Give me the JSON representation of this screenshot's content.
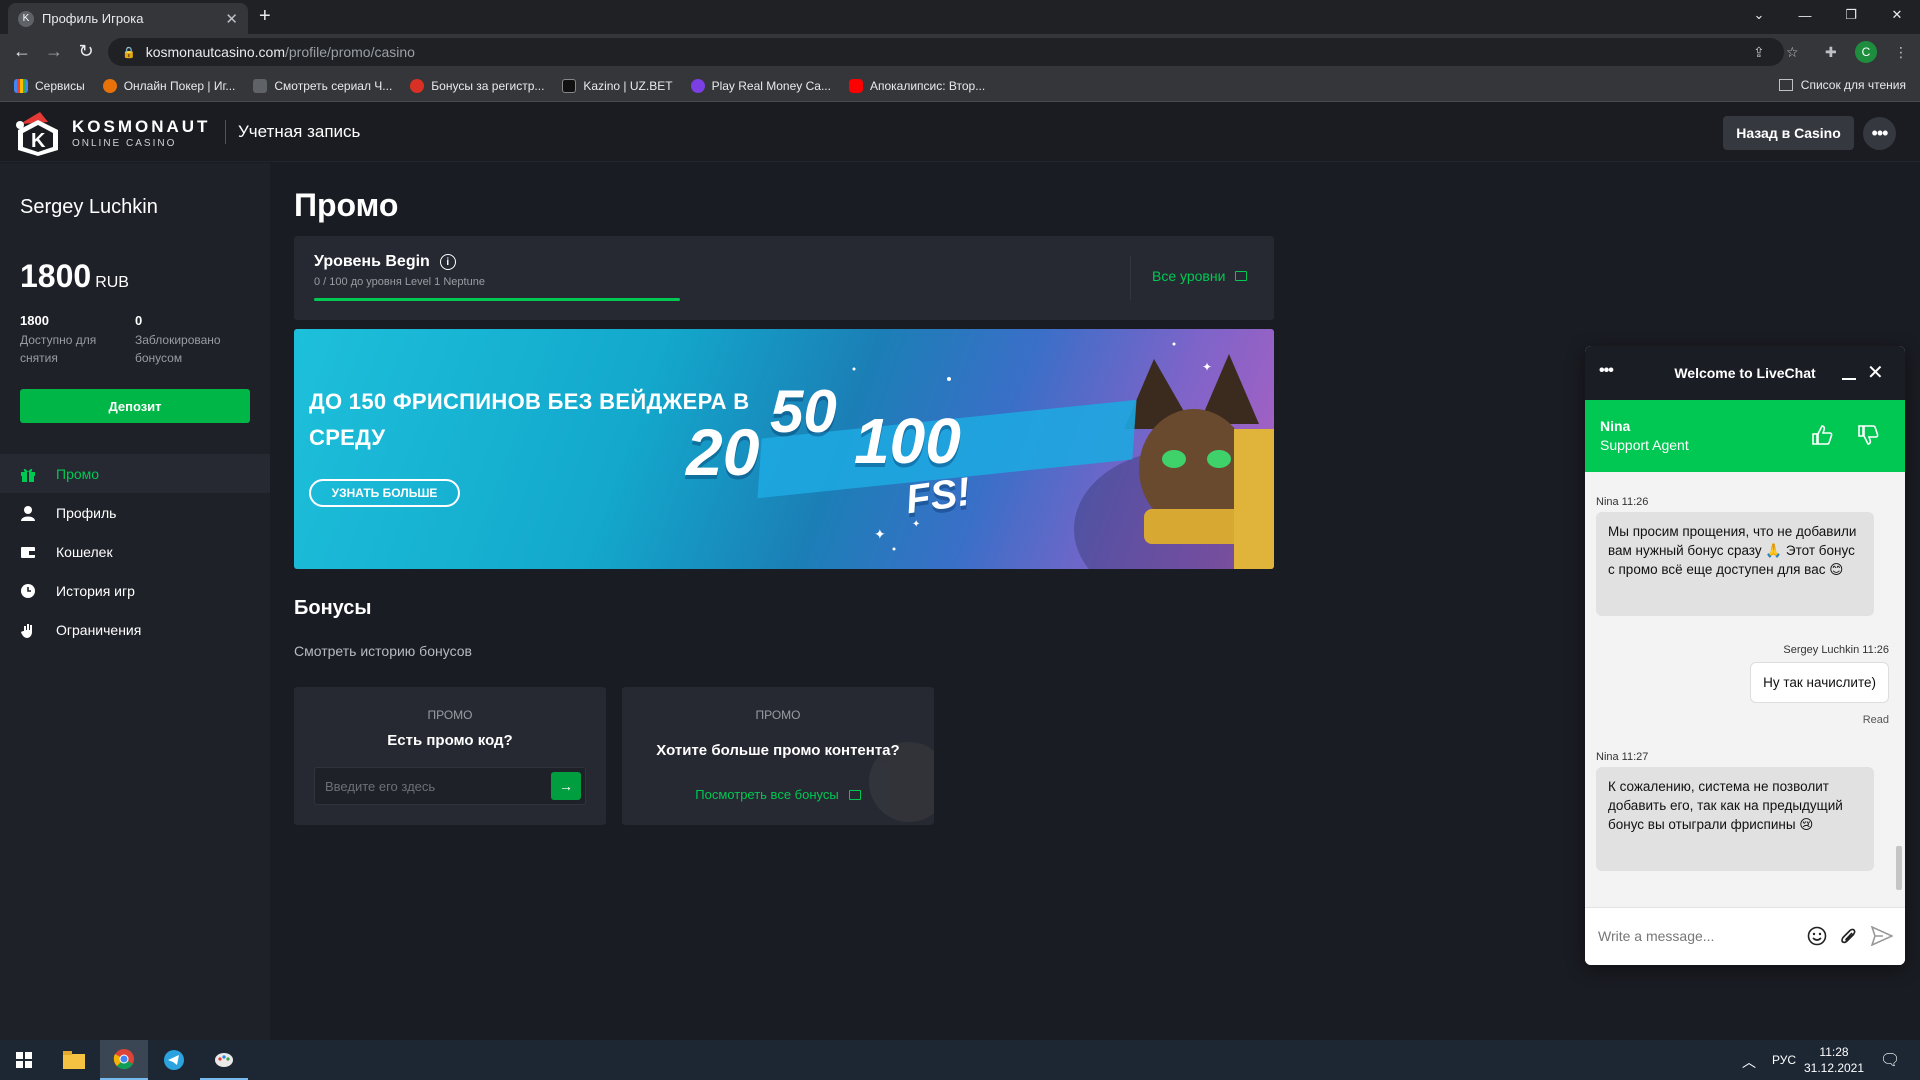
{
  "browser": {
    "tab_title": "Профиль Игрока",
    "tab_favicon": "K",
    "url_host": "kosmonautcasino.com",
    "url_path": "/profile/promo/casino",
    "profile_initial": "C",
    "bookmarks": [
      {
        "label": "Сервисы",
        "color": "#e8710a"
      },
      {
        "label": "Онлайн Покер | Иг...",
        "color": "#e8710a"
      },
      {
        "label": "Смотреть сериал Ч...",
        "color": "#5f6368"
      },
      {
        "label": "Бонусы за регистр...",
        "color": "#d93025"
      },
      {
        "label": "Kazino | UZ.BET",
        "color": "#1a73e8"
      },
      {
        "label": "Play Real Money Ca...",
        "color": "#7b3fe4"
      },
      {
        "label": "Апокалипсис: Втор...",
        "color": "#ff0000"
      }
    ],
    "reading_list": "Список для чтения"
  },
  "header": {
    "logo_main": "KOSMONAUT",
    "logo_sub": "ONLINE CASINO",
    "account_label": "Учетная запись",
    "back_button": "Назад в Casino"
  },
  "sidebar": {
    "user_name": "Sergey Luchkin",
    "balance": "1800",
    "currency": "RUB",
    "available_value": "1800",
    "available_label": "Доступно для снятия",
    "locked_value": "0",
    "locked_label": "Заблокировано бонусом",
    "deposit_button": "Депозит",
    "menu": [
      {
        "label": "Промо",
        "icon": "gift-icon",
        "active": true
      },
      {
        "label": "Профиль",
        "icon": "user-icon",
        "active": false
      },
      {
        "label": "Кошелек",
        "icon": "wallet-icon",
        "active": false
      },
      {
        "label": "История игр",
        "icon": "clock-icon",
        "active": false
      },
      {
        "label": "Ограничения",
        "icon": "hand-icon",
        "active": false
      }
    ]
  },
  "main": {
    "title": "Промо",
    "level": {
      "title": "Уровень Begin",
      "progress_text": "0 / 100 до уровня Level 1 Neptune",
      "all_levels": "Все уровни"
    },
    "banner": {
      "title": "ДО 150 ФРИСПИНОВ БЕЗ ВЕЙДЖЕРА В СРЕДУ",
      "button": "УЗНАТЬ БОЛЬШЕ",
      "num_a": "20",
      "num_b": "50",
      "num_c": "100",
      "fs": "FS!"
    },
    "bonuses_title": "Бонусы",
    "bonus_history_link": "Смотреть историю бонусов",
    "promo_code_card": {
      "label": "ПРОМО",
      "question": "Есть промо код?",
      "placeholder": "Введите его здесь"
    },
    "promo_content_card": {
      "label": "ПРОМО",
      "question": "Хотите больше промо контента?",
      "link": "Посмотреть все бонусы"
    }
  },
  "livechat": {
    "title": "Welcome to LiveChat",
    "agent_name": "Nina",
    "agent_role": "Support Agent",
    "messages": [
      {
        "meta": "Nina 11:26",
        "text": "Мы просим прощения, что не добавили вам нужный бонус сразу 🙏 Этот бонус с промо всё еще доступен для вас 😊"
      },
      {
        "meta": "Sergey Luchkin 11:26",
        "text": "Ну так начислите)",
        "status": "Read"
      },
      {
        "meta": "Nina 11:27",
        "text": "К сожалению, система не позволит добавить его, так как на предыдущий бонус вы отыграли фриспины 😢"
      }
    ],
    "input_placeholder": "Write a message..."
  },
  "taskbar": {
    "lang": "РУС",
    "time": "11:28",
    "date": "31.12.2021"
  }
}
